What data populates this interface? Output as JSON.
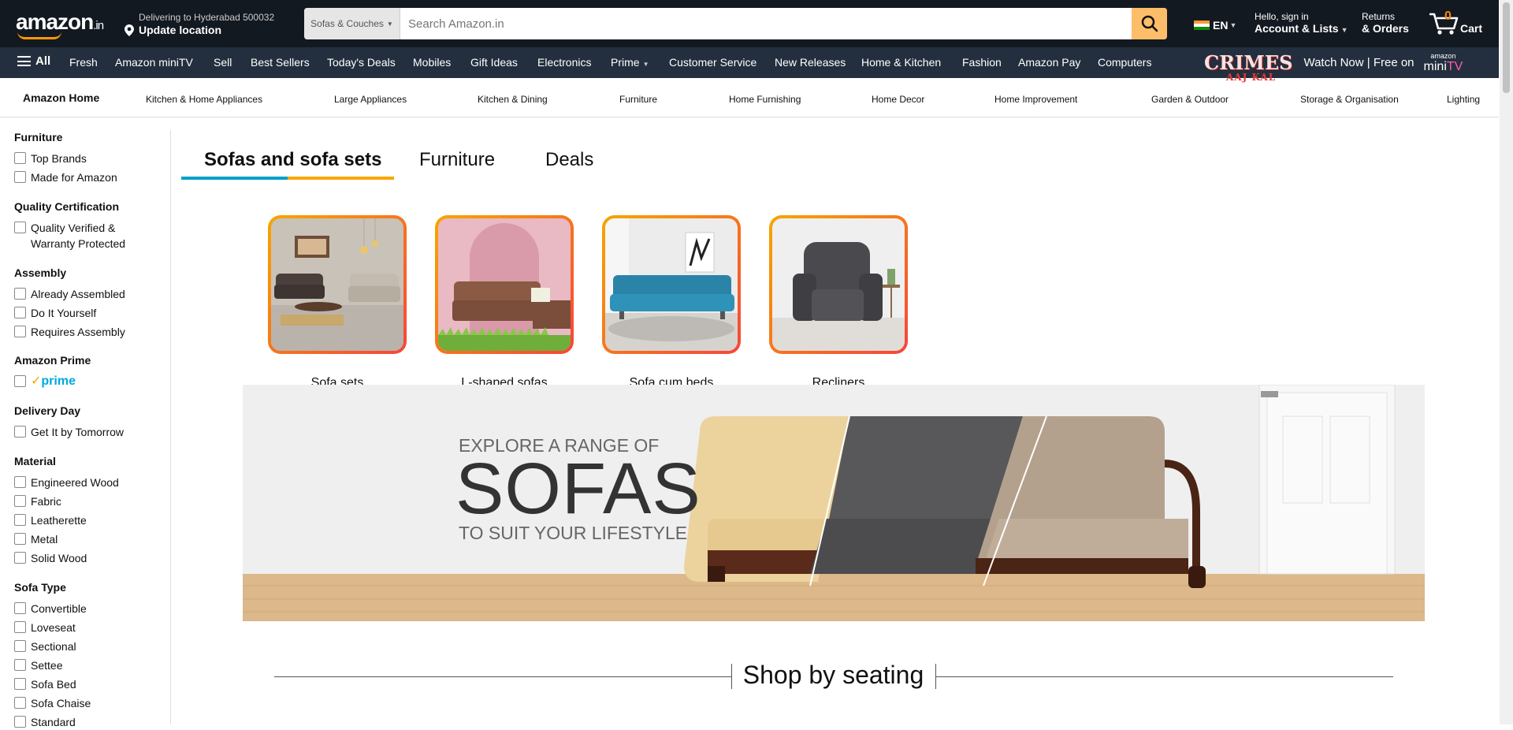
{
  "header": {
    "logo_text": "amazon",
    "logo_suffix": ".in",
    "deliver_line1": "Delivering to Hyderabad 500032",
    "deliver_line2": "Update location",
    "search_category": "Sofas & Couches",
    "search_placeholder": "Search Amazon.in",
    "language": "EN",
    "account_line1": "Hello, sign in",
    "account_line2": "Account & Lists",
    "returns_line1": "Returns",
    "returns_line2": "& Orders",
    "cart_count": "0",
    "cart_label": "Cart"
  },
  "nav": {
    "all_label": "All",
    "items": [
      "Fresh",
      "Amazon miniTV",
      "Sell",
      "Best Sellers",
      "Today's Deals",
      "Mobiles",
      "Gift Ideas",
      "Electronics",
      "Prime",
      "Customer Service",
      "New Releases",
      "Home & Kitchen",
      "Fashion",
      "Amazon Pay",
      "Computers"
    ],
    "promo_title": "CRIMES",
    "promo_sub": "AAJ KAL",
    "promo_text": "Watch Now | Free on",
    "minitv_top": "amazon",
    "minitv_main": "mini",
    "minitv_tv": "TV"
  },
  "subnav": {
    "home_label": "Amazon Home",
    "items": [
      "Kitchen & Home Appliances",
      "Large Appliances",
      "Kitchen & Dining",
      "Furniture",
      "Home Furnishing",
      "Home Decor",
      "Home Improvement",
      "Garden & Outdoor",
      "Storage & Organisation",
      "Lighting"
    ]
  },
  "filters": {
    "furniture": {
      "title": "Furniture",
      "options": [
        "Top Brands",
        "Made for Amazon"
      ]
    },
    "quality": {
      "title": "Quality Certification",
      "options": [
        "Quality Verified & Warranty Protected"
      ]
    },
    "assembly": {
      "title": "Assembly",
      "options": [
        "Already Assembled",
        "Do It Yourself",
        "Requires Assembly"
      ]
    },
    "prime": {
      "title": "Amazon Prime",
      "label": "prime"
    },
    "delivery": {
      "title": "Delivery Day",
      "options": [
        "Get It by Tomorrow"
      ]
    },
    "material": {
      "title": "Material",
      "options": [
        "Engineered Wood",
        "Fabric",
        "Leatherette",
        "Metal",
        "Solid Wood"
      ]
    },
    "sofa_type": {
      "title": "Sofa Type",
      "options": [
        "Convertible",
        "Loveseat",
        "Sectional",
        "Settee",
        "Sofa Bed",
        "Sofa Chaise",
        "Standard"
      ]
    }
  },
  "tabs": [
    "Sofas and sofa sets",
    "Furniture",
    "Deals"
  ],
  "tiles": [
    "Sofa sets",
    "L-shaped sofas",
    "Sofa cum beds",
    "Recliners"
  ],
  "banner": {
    "line1": "EXPLORE A RANGE OF",
    "line2": "SOFAS",
    "line3": "TO SUIT YOUR LIFESTYLE"
  },
  "section_title": "Shop by seating",
  "colors": {
    "header_bg": "#131921",
    "nav_bg": "#232f3e",
    "accent": "#febd69",
    "cart_orange": "#f08804",
    "prime_blue": "#00a8e1"
  }
}
